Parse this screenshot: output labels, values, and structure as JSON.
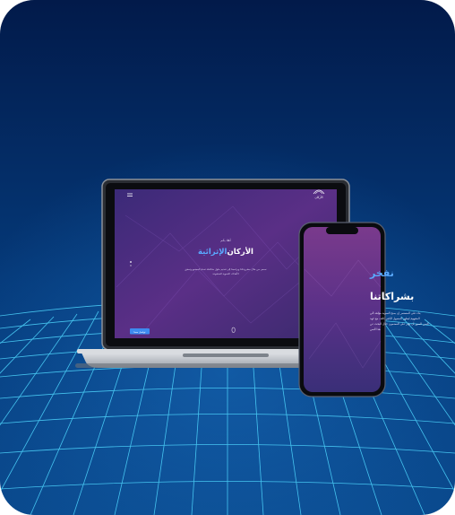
{
  "colors": {
    "background_top": "#021a4a",
    "background_mid": "#053a7a",
    "grid_line": "#4fd8ff",
    "screen_purple": "#5a2f86",
    "screen_magenta": "#7a3a8c",
    "accent_blue": "#5aa9ff",
    "laptop_silver": "#c8ccd2"
  },
  "laptop": {
    "logo_text": "الأركان",
    "hero_small_text": "أهلا بكم",
    "hero_title_part1": "الأركان",
    "hero_title_part2": "الإثرائية",
    "hero_desc_line1": "نسعى من خلال مشروعاتنا وبرامجنا إلى تقديم حلول متكاملة تخدم المجتمع وتحقق",
    "hero_desc_line2": "الأهداف التنموية المنشودة",
    "cta_label": "تواصل معنا",
    "menu_icon": "menu-icon",
    "scroll_icon": "mouse-scroll-icon"
  },
  "phone": {
    "heading_line1": "نفخر",
    "heading_line2": "بشراكاتنا",
    "paragraph": [
      "بناء على المستمر إن بمنح السوية مؤلفة الي",
      "المفهوم ليظهر المسهل الكثير كافة، مع جهد",
      "النص الصور أن يؤثر على المضمون خلال البحث عن",
      "هذا النص"
    ]
  }
}
